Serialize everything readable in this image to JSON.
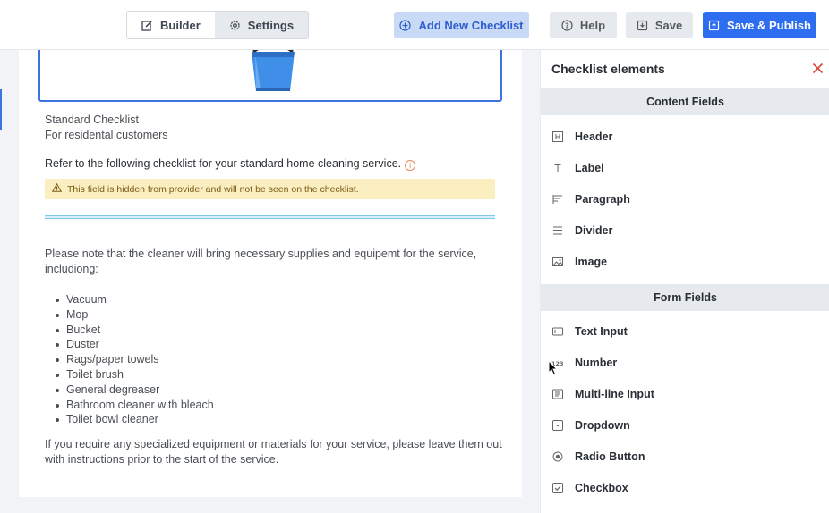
{
  "topbar": {
    "builder_label": "Builder",
    "settings_label": "Settings",
    "add_label": "Add New Checklist",
    "help_label": "Help",
    "save_label": "Save",
    "publish_label": "Save & Publish"
  },
  "content": {
    "title": "Standard Checklist",
    "subtitle": "For residental customers",
    "refer": "Refer to the following checklist for your standard home cleaning service.",
    "warning": "This field is hidden from provider and will not be seen on the checklist.",
    "note_line1": "Please note that the cleaner will bring necessary supplies and equipemt for the service,",
    "note_line2": "includiong:",
    "supplies": [
      "Vacuum",
      "Mop",
      "Bucket",
      "Duster",
      "Rags/paper towels",
      "Toilet brush",
      "General degreaser",
      "Bathroom cleaner with bleach",
      "Toilet bowl cleaner"
    ],
    "footer_line1": "If you require any specialized equipment or materials for your service, please leave them out",
    "footer_line2": "with instructions prior to the start of the service."
  },
  "panel": {
    "title": "Checklist elements",
    "content_header": "Content Fields",
    "content_items": [
      {
        "label": "Header",
        "icon": "header-icon"
      },
      {
        "label": "Label",
        "icon": "text-icon"
      },
      {
        "label": "Paragraph",
        "icon": "paragraph-icon"
      },
      {
        "label": "Divider",
        "icon": "divider-icon"
      },
      {
        "label": "Image",
        "icon": "image-icon"
      }
    ],
    "form_header": "Form Fields",
    "form_items": [
      {
        "label": "Text Input",
        "icon": "text-input-icon"
      },
      {
        "label": "Number",
        "icon": "number-icon"
      },
      {
        "label": "Multi-line Input",
        "icon": "multiline-icon"
      },
      {
        "label": "Dropdown",
        "icon": "dropdown-icon"
      },
      {
        "label": "Radio Button",
        "icon": "radio-icon"
      },
      {
        "label": "Checkbox",
        "icon": "checkbox-icon"
      }
    ]
  },
  "colors": {
    "primary": "#2d6ef0",
    "add_button_bg": "#c9daf7",
    "warning_bg": "#fbeec1",
    "close": "#e0463c"
  }
}
